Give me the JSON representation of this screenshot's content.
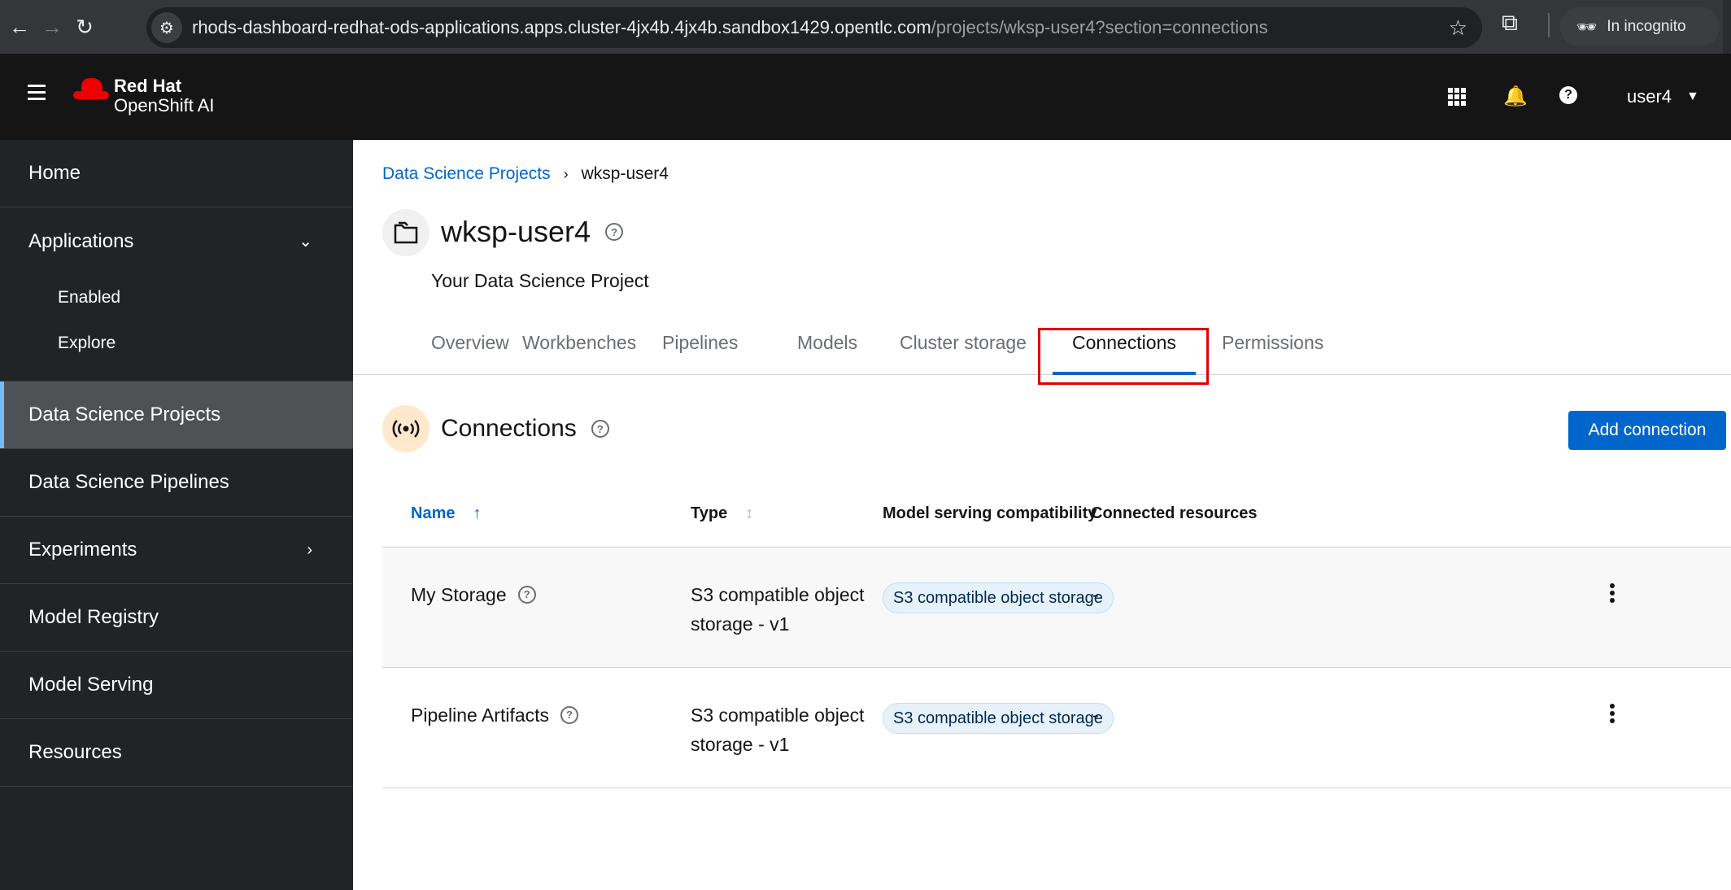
{
  "browser": {
    "url_host": "rhods-dashboard-redhat-ods-applications.apps.cluster-4jx4b.4jx4b.sandbox1429.opentlc.com",
    "url_path": "/projects/wksp-user4?section=connections",
    "incognito_label": "In incognito"
  },
  "masthead": {
    "brand_line1": "Red Hat",
    "brand_line2": "OpenShift AI",
    "user": "user4"
  },
  "sidebar": {
    "items": [
      {
        "label": "Home"
      },
      {
        "label": "Applications"
      },
      {
        "label": "Data Science Projects"
      },
      {
        "label": "Data Science Pipelines"
      },
      {
        "label": "Experiments"
      },
      {
        "label": "Model Registry"
      },
      {
        "label": "Model Serving"
      },
      {
        "label": "Resources"
      }
    ],
    "applications_sub": [
      {
        "label": "Enabled"
      },
      {
        "label": "Explore"
      }
    ]
  },
  "breadcrumb": {
    "parent": "Data Science Projects",
    "current": "wksp-user4"
  },
  "project": {
    "title": "wksp-user4",
    "description": "Your Data Science Project"
  },
  "tabs": [
    {
      "label": "Overview"
    },
    {
      "label": "Workbenches"
    },
    {
      "label": "Pipelines"
    },
    {
      "label": "Models"
    },
    {
      "label": "Cluster storage"
    },
    {
      "label": "Connections"
    },
    {
      "label": "Permissions"
    }
  ],
  "connections": {
    "title": "Connections",
    "add_button": "Add connection",
    "columns": {
      "name": "Name",
      "type": "Type",
      "compat": "Model serving compatibility",
      "resources": "Connected resources"
    },
    "rows": [
      {
        "name": "My Storage",
        "type_line1": "S3 compatible object",
        "type_line2": "storage - v1",
        "compat": "S3 compatible object storage",
        "resources": "-"
      },
      {
        "name": "Pipeline Artifacts",
        "type_line1": "S3 compatible object",
        "type_line2": "storage - v1",
        "compat": "S3 compatible object storage",
        "resources": "-"
      }
    ]
  },
  "colors": {
    "accent": "#0066cc",
    "highlight": "#e00000",
    "sidebar_bg": "#212427",
    "masthead_bg": "#151515"
  }
}
